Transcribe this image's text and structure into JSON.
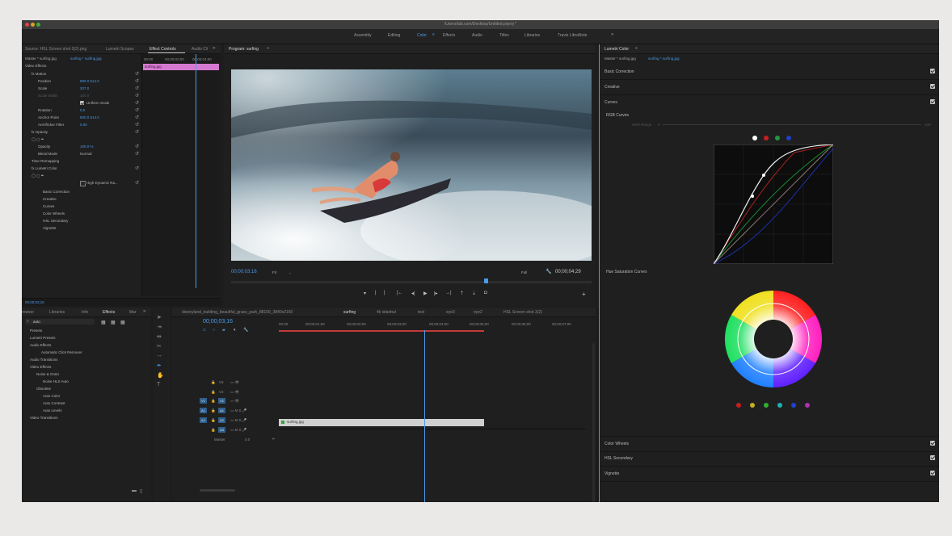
{
  "window": {
    "title": "/Users/tab.com/Desktop/Untitled.prproj *"
  },
  "workspaces": [
    {
      "label": "Assembly",
      "active": false
    },
    {
      "label": "Editing",
      "active": false
    },
    {
      "label": "Color",
      "active": true
    },
    {
      "label": "Effects",
      "active": false
    },
    {
      "label": "Audio",
      "active": false
    },
    {
      "label": "Titles",
      "active": false
    },
    {
      "label": "Libraries",
      "active": false
    },
    {
      "label": "Travis LibraNote",
      "active": false
    }
  ],
  "source_tabs": [
    "Source: HSL Screen shot 3(2).png",
    "Lumetri Scopes",
    "Effect Controls",
    "Audio Cli"
  ],
  "effect_controls": {
    "breadcrumb_master": "Master * surfing.jpg",
    "breadcrumb_clip": "surfing * surfing.jpg",
    "section_title": "Video Effects",
    "clip_label": "surfing.jpg",
    "ruler": [
      "00:00",
      "00;00;02;00",
      "00;00;04;00"
    ],
    "rows": [
      {
        "label": "fx  Motion",
        "value": ""
      },
      {
        "label": "Position",
        "value": "800.0   514.0"
      },
      {
        "label": "Scale",
        "value": "207.0"
      },
      {
        "label": "Scale Width",
        "value": "100.0"
      },
      {
        "label": "Uniform Scale",
        "value": ""
      },
      {
        "label": "Rotation",
        "value": "0.0"
      },
      {
        "label": "Anchor Point",
        "value": "800.0   514.0"
      },
      {
        "label": "Anti-flicker Filter",
        "value": "0.00"
      },
      {
        "label": "fx  Opacity",
        "value": ""
      },
      {
        "label": "Opacity",
        "value": "100.0 %"
      },
      {
        "label": "Blend Mode",
        "value": "Normal"
      },
      {
        "label": "Time Remapping",
        "value": ""
      },
      {
        "label": "fx  Lumetri Color",
        "value": ""
      },
      {
        "label": "High Dynamic Ra...",
        "value": ""
      },
      {
        "label": "Basic Correction",
        "value": ""
      },
      {
        "label": "Creative",
        "value": ""
      },
      {
        "label": "Curves",
        "value": ""
      },
      {
        "label": "Color Wheels",
        "value": ""
      },
      {
        "label": "HSL Secondary",
        "value": ""
      },
      {
        "label": "Vignette",
        "value": ""
      }
    ],
    "timecode": "00;00;03;16"
  },
  "program": {
    "tab": "Program: surfing",
    "timecode": "00;00;03;16",
    "fit": "Fit",
    "quality": "Full",
    "duration": "00;00;04;29"
  },
  "project": {
    "tabs": [
      "rowser",
      "Libraries",
      "Info",
      "Effects",
      "Mar"
    ],
    "search": "auto",
    "tree": [
      {
        "label": "Presets",
        "depth": 0
      },
      {
        "label": "Lumetri Presets",
        "depth": 0
      },
      {
        "label": "Audio Effects",
        "depth": 0
      },
      {
        "label": "Automatic Click Remover",
        "depth": 1
      },
      {
        "label": "Audio Transitions",
        "depth": 0
      },
      {
        "label": "Video Effects",
        "depth": 0
      },
      {
        "label": "Noise & Grain",
        "depth": 1
      },
      {
        "label": "Noise HLS Auto",
        "depth": 2
      },
      {
        "label": "Obsolete",
        "depth": 1
      },
      {
        "label": "Auto Color",
        "depth": 2
      },
      {
        "label": "Auto Contrast",
        "depth": 2
      },
      {
        "label": "Auto Levels",
        "depth": 2
      },
      {
        "label": "Video Transitions",
        "depth": 0
      }
    ]
  },
  "timeline": {
    "tabs": [
      "disneyland_building_beautiful_grass_park_88109_3840x2160",
      "surfing",
      "4k istanbul",
      "test",
      "eye3",
      "eye2",
      "HSL Screen shot 3(2)"
    ],
    "timecode": "00;00;03;16",
    "ruler": [
      "00:00",
      "00;00;01;00",
      "00;00;02;00",
      "00;00;03;00",
      "00;00;04;00",
      "00;00;05;00",
      "00;00;06;00",
      "00;00;07;00"
    ],
    "tracks_video": [
      "V3",
      "V2",
      "V1"
    ],
    "tracks_audio": [
      "A1",
      "A2",
      "A3"
    ],
    "master_label": "Master",
    "master_value": "0.0",
    "clip": "surfing.jpg"
  },
  "lumetri": {
    "tab": "Lumetri Color",
    "breadcrumb_master": "Master * surfing.jpg",
    "breadcrumb_clip": "surfing * surfing.jpg",
    "sections_top": [
      "Basic Correction",
      "Creative",
      "Curves"
    ],
    "rgb_curves": "RGB Curves",
    "hdr_range": "HDR Range",
    "hdr_min": "0",
    "hdr_max": "100",
    "hue_sat": "Hue Saturation Curves",
    "sections_bottom": [
      "Color Wheels",
      "HSL Secondary",
      "Vignette"
    ],
    "channel_colors": [
      "#ffffff",
      "#d02020",
      "#20a040",
      "#2040d0"
    ],
    "hue_dots": [
      "#d02020",
      "#d0c020",
      "#30c030",
      "#20c0c0",
      "#2040d0",
      "#c030c0"
    ]
  }
}
